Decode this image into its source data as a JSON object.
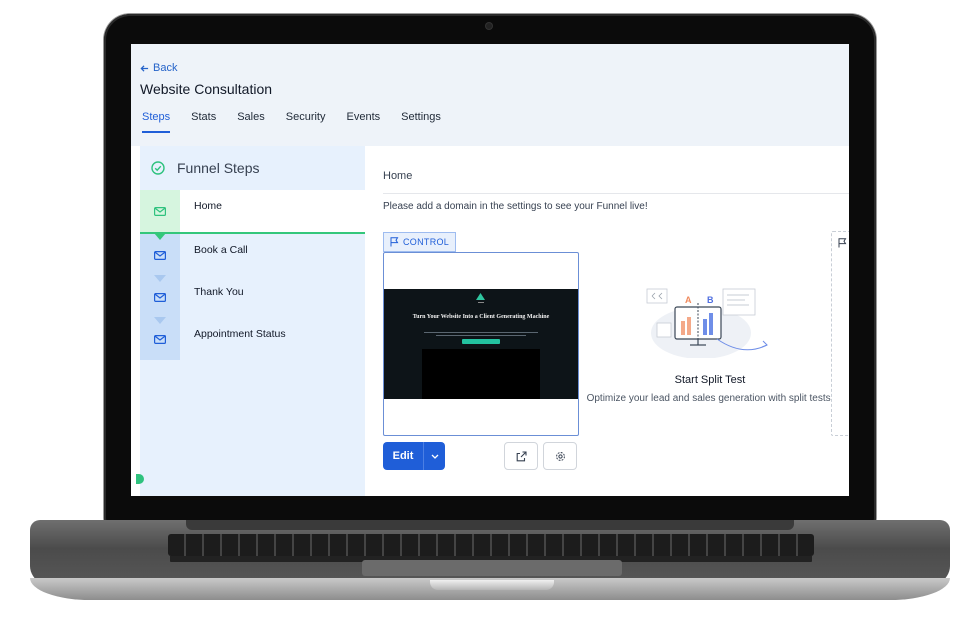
{
  "header": {
    "back_label": "Back",
    "title": "Website Consultation",
    "tabs": [
      {
        "label": "Steps",
        "active": true
      },
      {
        "label": "Stats"
      },
      {
        "label": "Sales"
      },
      {
        "label": "Security"
      },
      {
        "label": "Events"
      },
      {
        "label": "Settings"
      }
    ]
  },
  "sidebar": {
    "heading": "Funnel Steps",
    "steps": [
      {
        "label": "Home",
        "active": true,
        "icon": "envelope-icon"
      },
      {
        "label": "Book a Call",
        "icon": "envelope-icon"
      },
      {
        "label": "Thank You",
        "icon": "envelope-icon"
      },
      {
        "label": "Appointment Status",
        "icon": "envelope-icon"
      }
    ]
  },
  "main": {
    "breadcrumb": "Home",
    "notice": "Please add a domain in the settings to see your Funnel live!",
    "control_badge": "CONTROL",
    "preview": {
      "headline": "Turn Your Website Into a Client Generating Machine"
    },
    "edit_label": "Edit",
    "split_test": {
      "title": "Start Split Test",
      "description": "Optimize your lead and sales generation with split tests.",
      "label_a": "A",
      "label_b": "B"
    }
  },
  "colors": {
    "accent": "#1f5ed8",
    "success": "#34c77b",
    "sidebar_bg": "#e7f1fd",
    "header_bg": "#eef3f9"
  }
}
